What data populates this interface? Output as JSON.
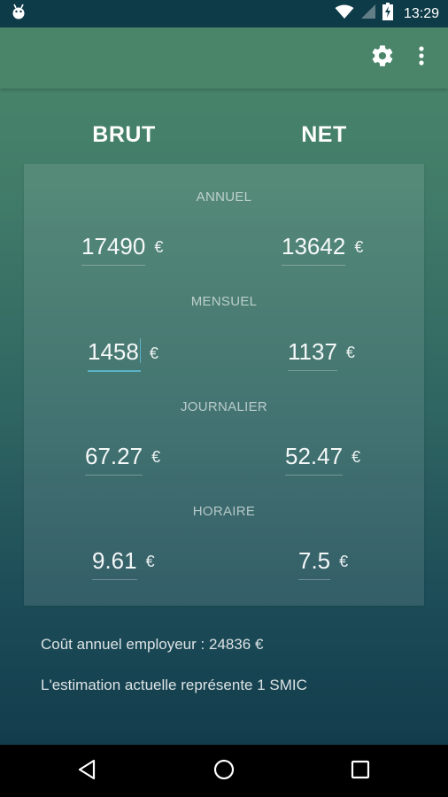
{
  "status_bar": {
    "time": "13:29"
  },
  "toolbar": {
    "settings_icon": "gear-icon",
    "more_icon": "more-vert-icon"
  },
  "columns": {
    "brut": "BRUT",
    "net": "NET"
  },
  "sections": {
    "annuel": {
      "label": "ANNUEL",
      "brut": "17490",
      "net": "13642"
    },
    "mensuel": {
      "label": "MENSUEL",
      "brut": "1458",
      "net": "1137"
    },
    "journalier": {
      "label": "JOURNALIER",
      "brut": "67.27",
      "net": "52.47"
    },
    "horaire": {
      "label": "HORAIRE",
      "brut": "9.61",
      "net": "7.5"
    }
  },
  "currency": "€",
  "info": {
    "employer_cost": "Coût annuel employeur : 24836 €",
    "smic": "L'estimation actuelle représente 1 SMIC"
  },
  "colors": {
    "accent": "#5bb2c8",
    "toolbar": "#4a8469",
    "status_bar": "#0e3b48"
  }
}
